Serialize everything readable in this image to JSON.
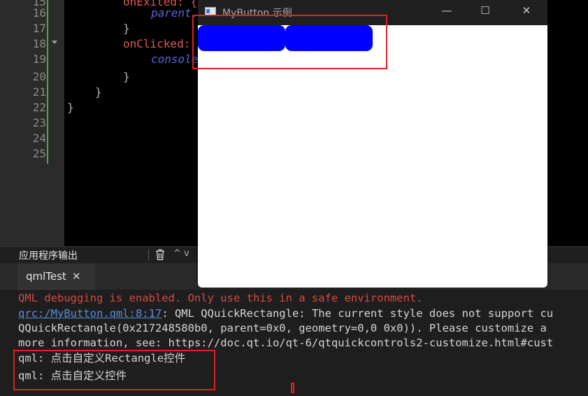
{
  "editor": {
    "line_numbers": [
      "15",
      "16",
      "17",
      "18",
      "19",
      "20",
      "21",
      "22",
      "23",
      "24",
      "25"
    ],
    "code": {
      "l15": "onExited: {",
      "l16": "parent.",
      "l17": "}",
      "l18_key": "onClicked",
      "l18_rest": ":",
      "l19": "console",
      "l20": "}",
      "l21": "}",
      "l22": "}"
    }
  },
  "app_output": {
    "panel_title": "应用程序输出",
    "up_glyph": "^  v",
    "tab_label": "qmlTest",
    "tab_close": "✕",
    "lines": {
      "line1": "QML debugging is enabled. Only use this in a safe environment.",
      "line2_link": "qrc:/MyButton.qml:8:17",
      "line2_rest": ": QML QQuickRectangle: The current style does not support cu",
      "line3": "QQuickRectangle(0x217248580b0, parent=0x0, geometry=0,0 0x0)). Please customize a",
      "line4": "more information, see: https://doc.qt.io/qt-6/qtquickcontrols2-customize.html#cust",
      "line5": "qml: 点击自定义Rectangle控件",
      "line6": "qml: 点击自定义控件"
    }
  },
  "preview_window": {
    "title": "MyButton 示例",
    "minimize": "—",
    "maximize": "☐",
    "close": "✕",
    "button_color": "#0000ff"
  },
  "colors": {
    "highlight_box": "#e02020",
    "error_text": "#d34a44",
    "link_text": "#5a8ed8"
  }
}
